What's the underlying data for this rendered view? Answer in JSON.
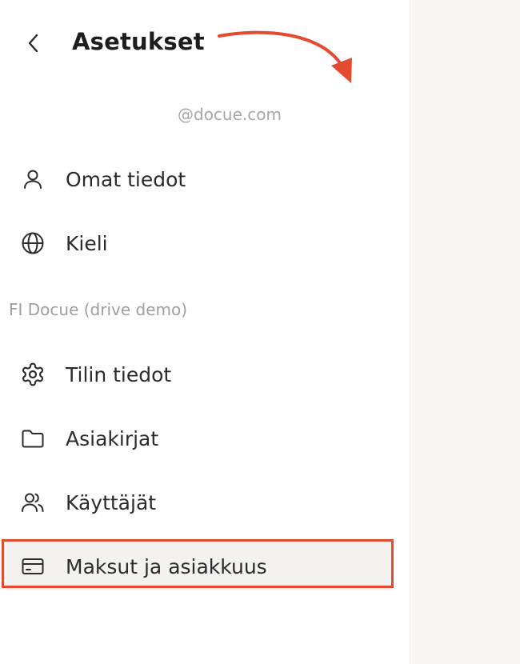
{
  "header": {
    "title": "Asetukset",
    "back_icon": "chevron-left-icon"
  },
  "user": {
    "email": "@docue.com"
  },
  "personal_items": [
    {
      "label": "Omat tiedot",
      "icon": "user-icon"
    },
    {
      "label": "Kieli",
      "icon": "globe-icon"
    }
  ],
  "org_section": {
    "label": "FI Docue (drive demo)"
  },
  "org_items": [
    {
      "label": "Tilin tiedot",
      "icon": "gear-icon"
    },
    {
      "label": "Asiakirjat",
      "icon": "folder-icon"
    },
    {
      "label": "Käyttäjät",
      "icon": "users-icon"
    },
    {
      "label": "Maksut ja asiakkuus",
      "icon": "credit-card-icon",
      "selected": true
    }
  ],
  "colors": {
    "annotation": "#e34a2f",
    "text": "#2b2b2b",
    "muted_text": "#a9a7a4",
    "main_background": "#f8f7f5",
    "selected_background": "#f3f2f0"
  }
}
